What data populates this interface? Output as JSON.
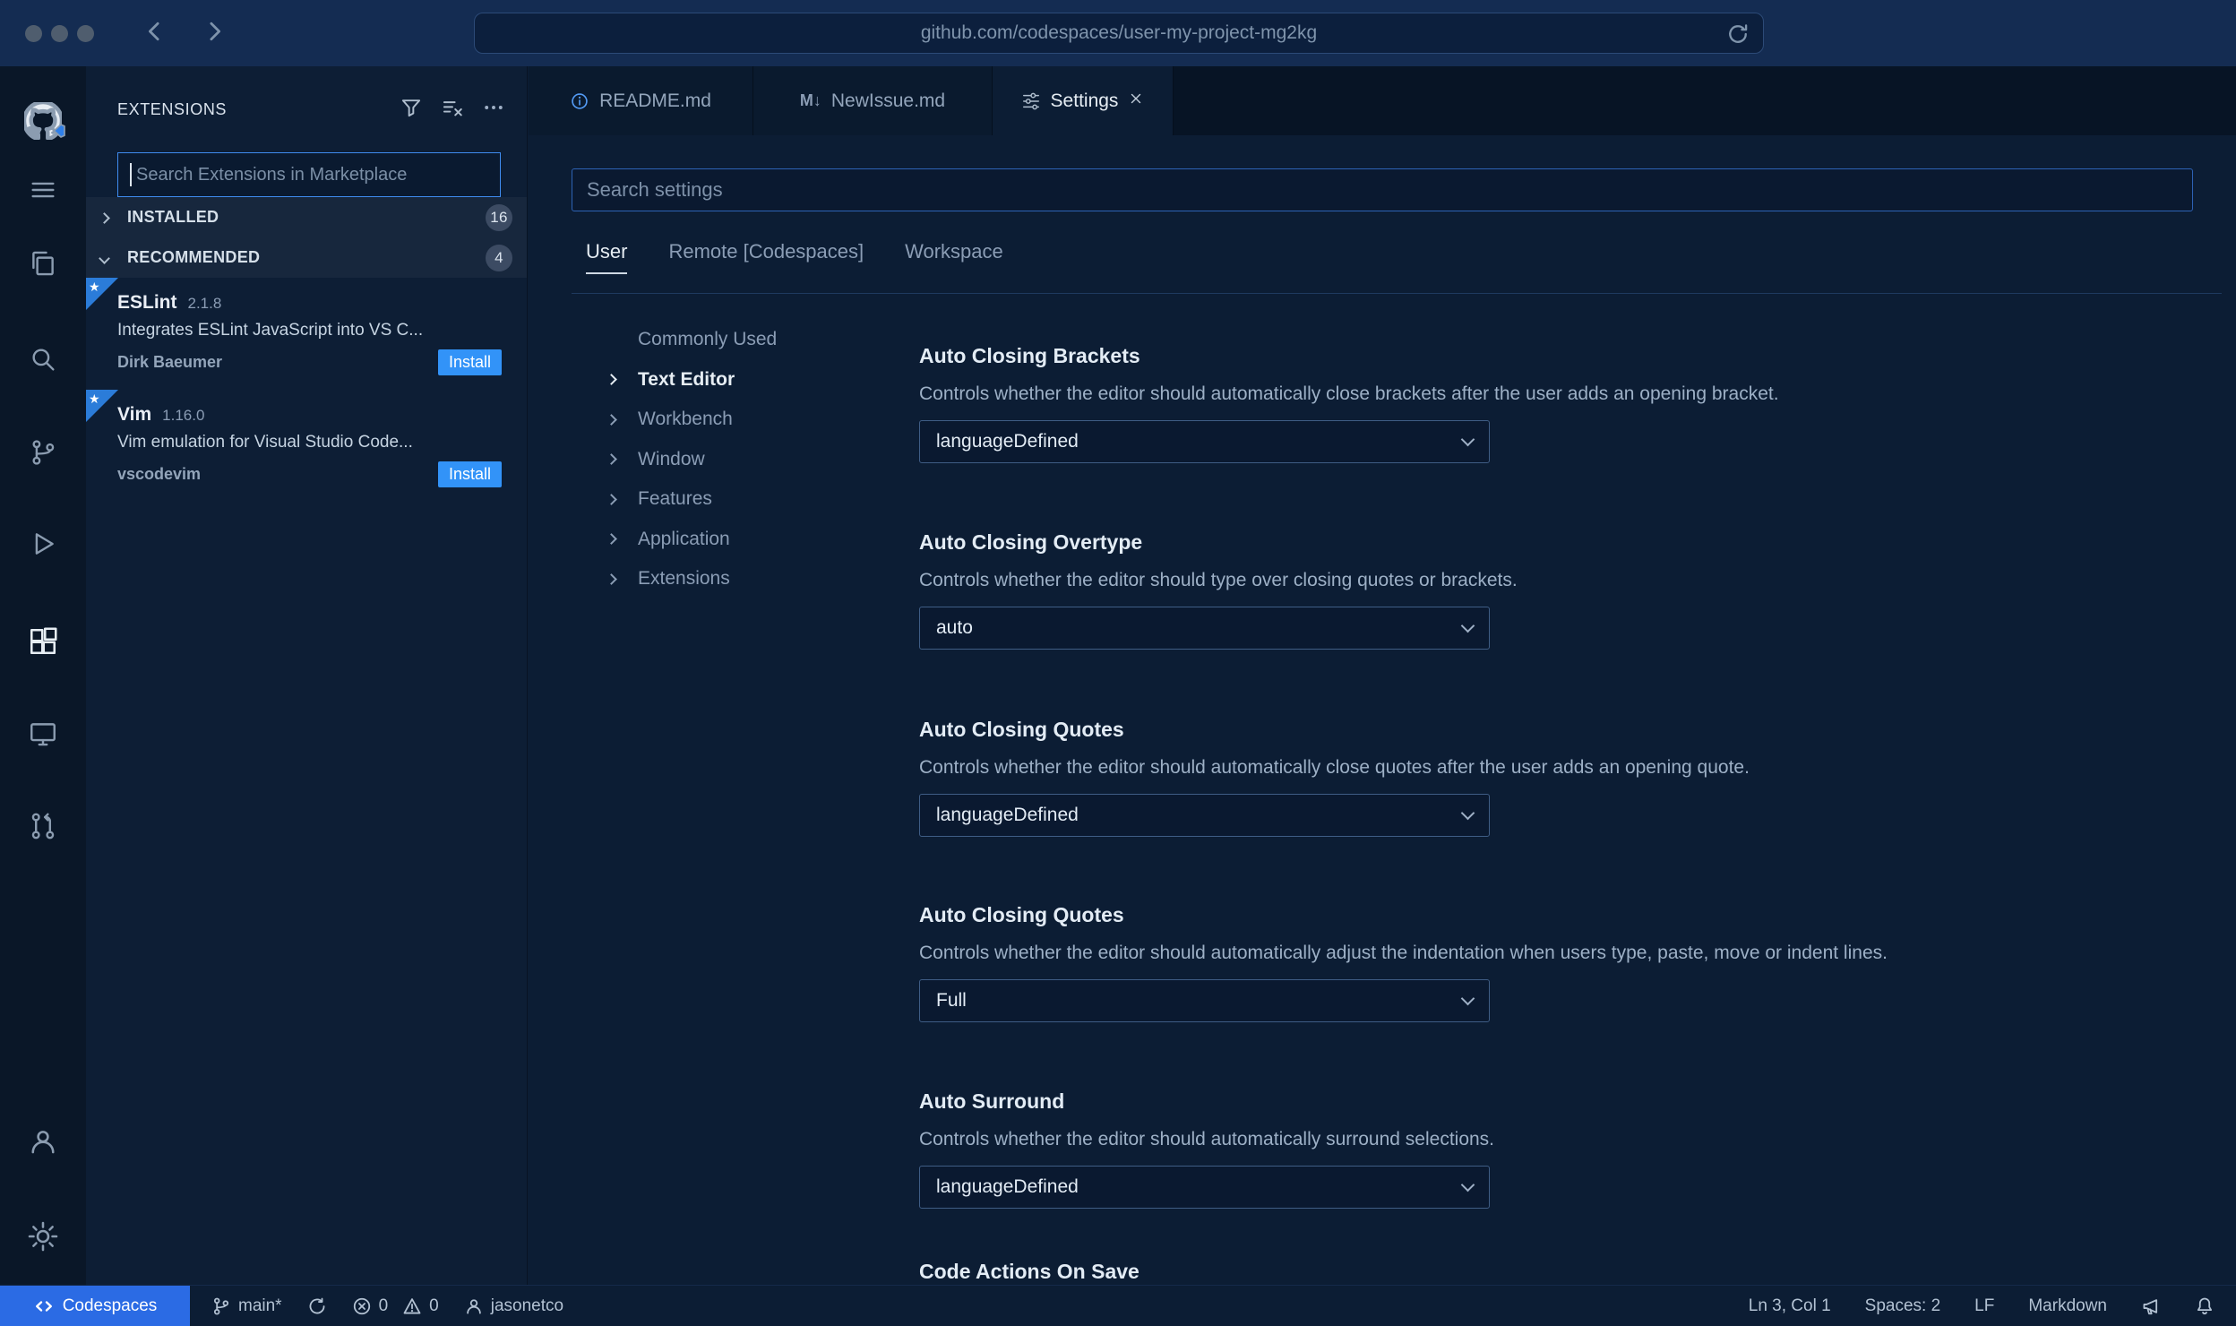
{
  "browser": {
    "url": "github.com/codespaces/user-my-project-mg2kg"
  },
  "icon_glyphs": {
    "markdown": "M↓",
    "star": "★"
  },
  "sidebar": {
    "title": "EXTENSIONS",
    "search_placeholder": "Search Extensions in Marketplace",
    "sections": [
      {
        "label": "INSTALLED",
        "count": "16"
      },
      {
        "label": "RECOMMENDED",
        "count": "4"
      }
    ],
    "extensions": [
      {
        "name": "ESLint",
        "version": "2.1.8",
        "description": "Integrates ESLint JavaScript into VS C...",
        "publisher": "Dirk Baeumer",
        "action_label": "Install"
      },
      {
        "name": "Vim",
        "version": "1.16.0",
        "description": "Vim emulation for Visual Studio Code...",
        "publisher": "vscodevim",
        "action_label": "Install"
      }
    ]
  },
  "editor_tabs": [
    {
      "label": "README.md"
    },
    {
      "label": "NewIssue.md"
    },
    {
      "label": "Settings"
    }
  ],
  "settings_editor": {
    "search_placeholder": "Search settings",
    "scopes": [
      {
        "label": "User"
      },
      {
        "label": "Remote [Codespaces]"
      },
      {
        "label": "Workspace"
      }
    ],
    "toc": [
      {
        "label": "Commonly Used"
      },
      {
        "label": "Text Editor"
      },
      {
        "label": "Workbench"
      },
      {
        "label": "Window"
      },
      {
        "label": "Features"
      },
      {
        "label": "Application"
      },
      {
        "label": "Extensions"
      }
    ],
    "items": [
      {
        "title": "Auto Closing Brackets",
        "description": "Controls whether the editor should automatically close brackets after the user adds an opening bracket.",
        "value": "languageDefined"
      },
      {
        "title": "Auto Closing Overtype",
        "description": "Controls whether the editor should type over closing quotes or brackets.",
        "value": "auto"
      },
      {
        "title": "Auto Closing Quotes",
        "description": "Controls whether the editor should automatically close quotes after the user adds an opening quote.",
        "value": "languageDefined"
      },
      {
        "title": "Auto Closing Quotes",
        "description": "Controls whether the editor should automatically adjust the indentation when users type, paste, move or indent lines.",
        "value": "Full"
      },
      {
        "title": "Auto Surround",
        "description": "Controls whether the editor should automatically surround selections.",
        "value": "languageDefined"
      },
      {
        "title": "Code Actions On Save"
      }
    ]
  },
  "status_bar": {
    "remote_label": "Codespaces",
    "branch": "main*",
    "error_count": "0",
    "warning_count": "0",
    "user": "jasonetco",
    "cursor": "Ln 3, Col 1",
    "indent": "Spaces: 2",
    "eol": "LF",
    "language": "Markdown"
  }
}
